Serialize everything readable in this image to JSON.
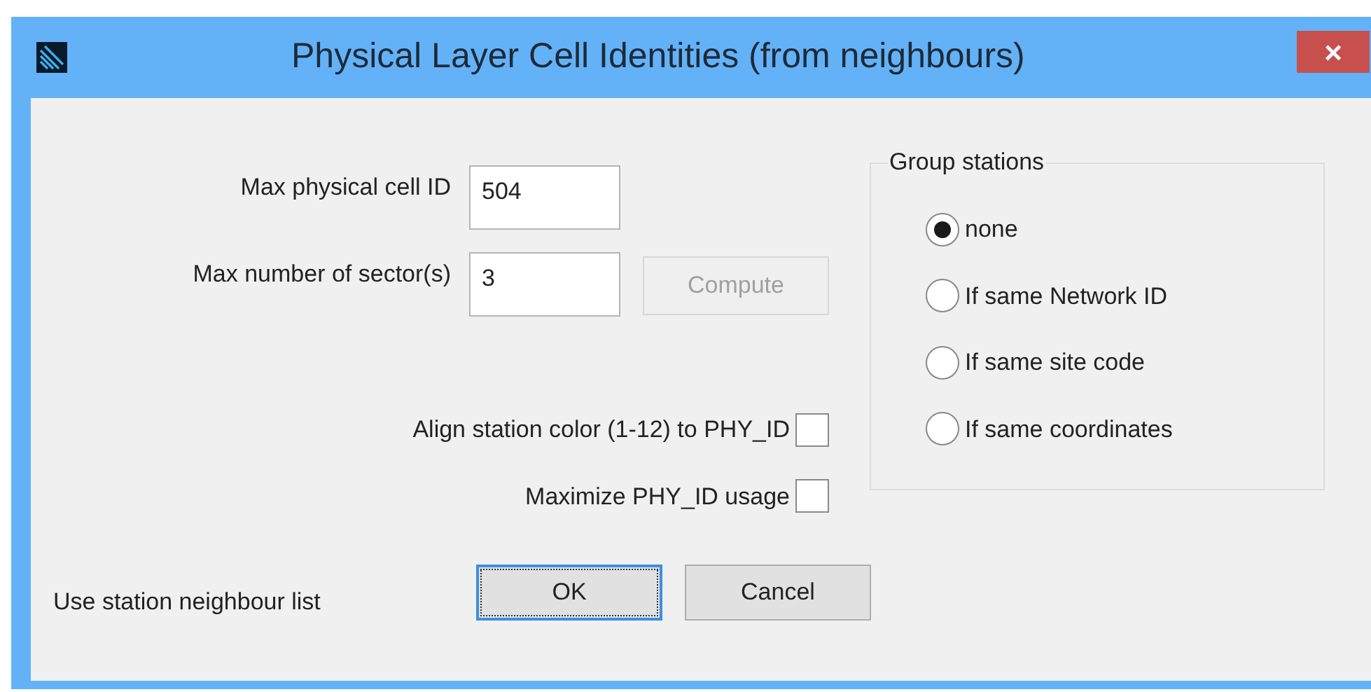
{
  "window": {
    "title": "Physical Layer Cell Identities (from neighbours)",
    "close": "×"
  },
  "fields": [
    {
      "label": "Max physical cell ID",
      "value": "504"
    },
    {
      "label": "Max number of sector(s)",
      "value": "3"
    }
  ],
  "compute_button": {
    "label": "Compute",
    "disabled": true
  },
  "checkboxes": [
    {
      "label": "Align station color (1-12) to PHY_ID",
      "checked": false
    },
    {
      "label": "Maximize PHY_ID usage",
      "checked": false
    }
  ],
  "neighbour_label": "Use station neighbour list",
  "buttons": [
    {
      "label": "OK",
      "focused": true
    },
    {
      "label": "Cancel",
      "focused": false
    }
  ],
  "group": {
    "title": "Group stations",
    "options": [
      {
        "label": "none",
        "selected": true
      },
      {
        "label": "If same Network ID",
        "selected": false
      },
      {
        "label": "If same site code",
        "selected": false
      },
      {
        "label": "If same coordinates",
        "selected": false
      }
    ]
  }
}
